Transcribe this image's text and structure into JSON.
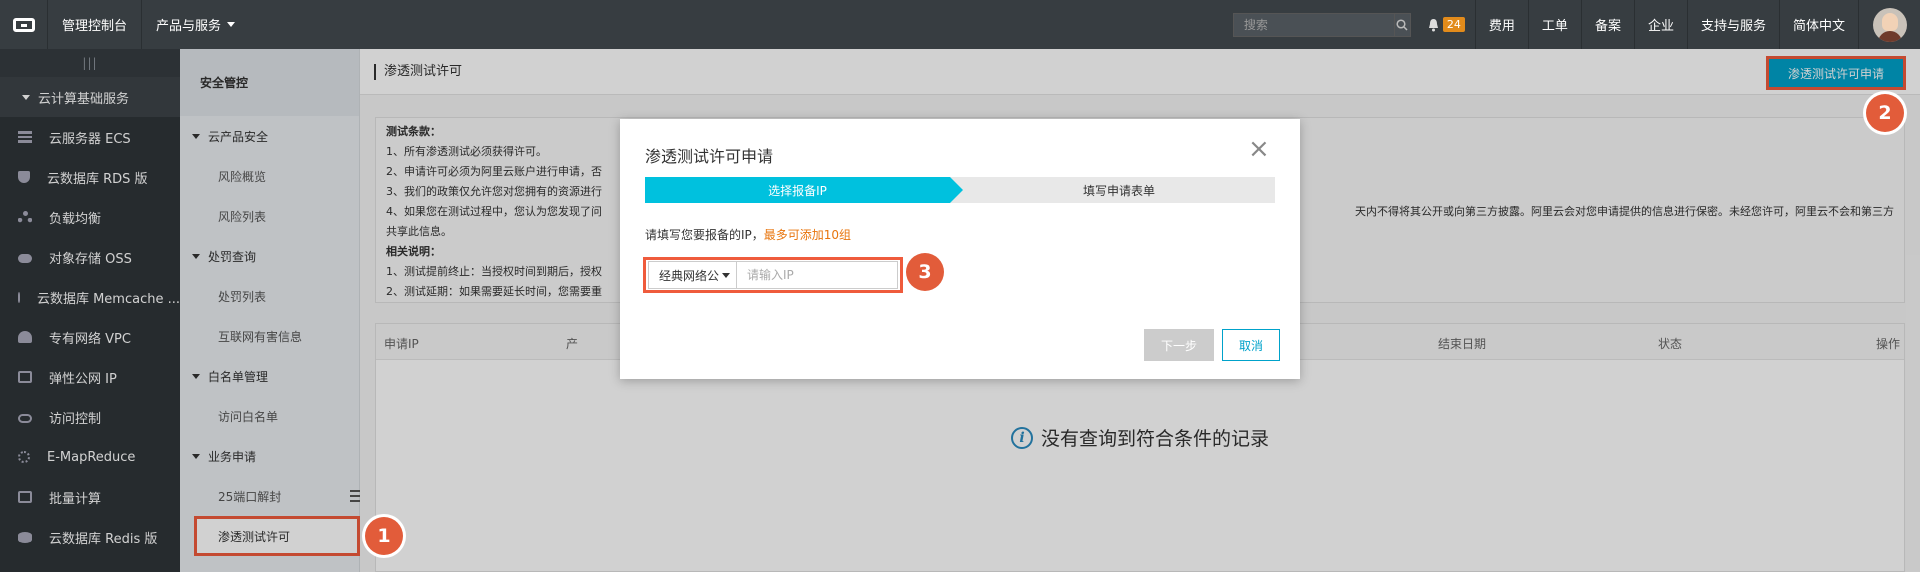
{
  "topbar": {
    "console_label": "管理控制台",
    "products_label": "产品与服务",
    "search_placeholder": "搜索",
    "notification_count": "24",
    "links": [
      "费用",
      "工单",
      "备案",
      "企业",
      "支持与服务",
      "简体中文"
    ]
  },
  "sidebar": {
    "handle": "|||",
    "group_label": "云计算基础服务",
    "items": [
      {
        "label": "云服务器 ECS",
        "icon": "server-icon"
      },
      {
        "label": "云数据库 RDS 版",
        "icon": "database-icon"
      },
      {
        "label": "负载均衡",
        "icon": "load-balancer-icon"
      },
      {
        "label": "对象存储 OSS",
        "icon": "cloud-storage-icon"
      },
      {
        "label": "云数据库 Memcache ...",
        "icon": "memcache-icon"
      },
      {
        "label": "专有网络 VPC",
        "icon": "vpc-icon"
      },
      {
        "label": "弹性公网 IP",
        "icon": "eip-icon"
      },
      {
        "label": "访问控制",
        "icon": "access-control-icon"
      },
      {
        "label": "E-MapReduce",
        "icon": "emapreduce-icon"
      },
      {
        "label": "批量计算",
        "icon": "batch-compute-icon"
      },
      {
        "label": "云数据库 Redis 版",
        "icon": "redis-icon"
      }
    ]
  },
  "subnav": {
    "title": "安全管控",
    "groups": [
      {
        "label": "云产品安全",
        "items": [
          "风险概览",
          "风险列表"
        ]
      },
      {
        "label": "处罚查询",
        "items": [
          "处罚列表",
          "互联网有害信息"
        ]
      },
      {
        "label": "白名单管理",
        "items": [
          "访问白名单"
        ]
      },
      {
        "label": "业务申请",
        "items": [
          "25端口解封",
          "渗透测试许可"
        ]
      }
    ]
  },
  "main": {
    "page_title": "渗透测试许可",
    "apply_button": "渗透测试许可申请",
    "terms": {
      "heading": "测试条款：",
      "lines": [
        "1、所有渗透测试必须获得许可。",
        "2、申请许可必须为阿里云账户进行申请，否",
        "3、我们的政策仅允许您对您拥有的资源进行",
        "4、如果您在测试过程中，您认为您发现了问"
      ],
      "line4_tail": "天内不得将其公开或向第三方披露。阿里云会对您申请提供的信息进行保密。未经您许可，阿里云不会和第三方",
      "line4_cont": "共享此信息。",
      "related_heading": "相关说明：",
      "related_lines": [
        "1、测试提前终止：当授权时间到期后，授权",
        "2、测试延期：如果需要延长时间，您需要重"
      ]
    },
    "table": {
      "columns": [
        "申请IP",
        "产",
        "结束日期",
        "状态",
        "操作"
      ],
      "empty_text": "没有查询到符合条件的记录"
    }
  },
  "modal": {
    "title": "渗透测试许可申请",
    "steps": [
      "选择报备IP",
      "填写申请表单"
    ],
    "hint": "请填写您要报备的IP，",
    "hint_highlight": "最多可添加10组",
    "network_type": "经典网络公",
    "ip_placeholder": "请输入IP",
    "next_button": "下一步",
    "cancel_button": "取消"
  },
  "markers": [
    "1",
    "2",
    "3"
  ],
  "colors": {
    "accent": "#00a2ca",
    "step_active": "#00c1de",
    "highlight_border": "#ef5b3c",
    "marker": "#e25c3a"
  }
}
